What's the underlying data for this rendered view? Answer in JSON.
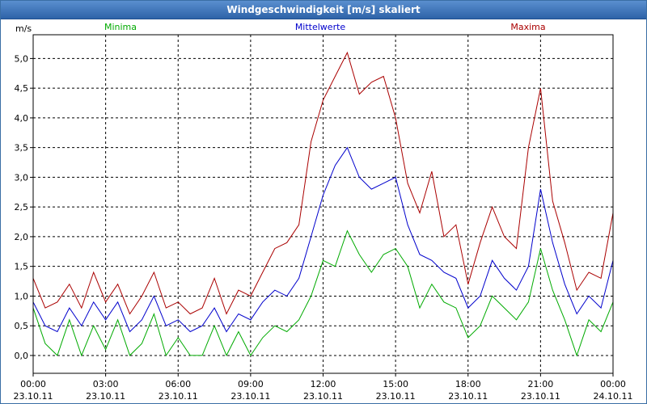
{
  "window": {
    "title": "Windgeschwindigkeit [m/s] skaliert"
  },
  "chart_data": {
    "type": "line",
    "title": "Windgeschwindigkeit [m/s] skaliert",
    "ylabel": "m/s",
    "xlabel": "",
    "ylim": [
      -0.3,
      5.4
    ],
    "yticks": [
      {
        "value": 0.0,
        "label": "0,0"
      },
      {
        "value": 0.5,
        "label": "0,5"
      },
      {
        "value": 1.0,
        "label": "1,0"
      },
      {
        "value": 1.5,
        "label": "1,5"
      },
      {
        "value": 2.0,
        "label": "2,0"
      },
      {
        "value": 2.5,
        "label": "2,5"
      },
      {
        "value": 3.0,
        "label": "3,0"
      },
      {
        "value": 3.5,
        "label": "3,5"
      },
      {
        "value": 4.0,
        "label": "4,0"
      },
      {
        "value": 4.5,
        "label": "4,5"
      },
      {
        "value": 5.0,
        "label": "5,0"
      }
    ],
    "xrange_hours": [
      0,
      24
    ],
    "xticks": [
      {
        "hours": 0,
        "time": "00:00",
        "date": "23.10.11"
      },
      {
        "hours": 3,
        "time": "03:00",
        "date": "23.10.11"
      },
      {
        "hours": 6,
        "time": "06:00",
        "date": "23.10.11"
      },
      {
        "hours": 9,
        "time": "09:00",
        "date": "23.10.11"
      },
      {
        "hours": 12,
        "time": "12:00",
        "date": "23.10.11"
      },
      {
        "hours": 15,
        "time": "15:00",
        "date": "23.10.11"
      },
      {
        "hours": 18,
        "time": "18:00",
        "date": "23.10.11"
      },
      {
        "hours": 21,
        "time": "21:00",
        "date": "23.10.11"
      },
      {
        "hours": 24,
        "time": "00:00",
        "date": "24.10.11"
      }
    ],
    "grid": true,
    "legend_placement": "top",
    "series": [
      {
        "name": "Minima",
        "color": "#00aa00",
        "x": [
          0,
          0.5,
          1,
          1.5,
          2,
          2.5,
          3,
          3.5,
          4,
          4.5,
          5,
          5.5,
          6,
          6.5,
          7,
          7.5,
          8,
          8.5,
          9,
          9.5,
          10,
          10.5,
          11,
          11.5,
          12,
          12.5,
          13,
          13.5,
          14,
          14.5,
          15,
          15.5,
          16,
          16.5,
          17,
          17.5,
          18,
          18.5,
          19,
          19.5,
          20,
          20.5,
          21,
          21.5,
          22,
          22.5,
          23,
          23.5,
          24
        ],
        "values": [
          0.8,
          0.2,
          0.0,
          0.6,
          0.0,
          0.5,
          0.1,
          0.6,
          0.0,
          0.2,
          0.7,
          0.0,
          0.3,
          0.0,
          0.0,
          0.5,
          0.0,
          0.4,
          0.0,
          0.3,
          0.5,
          0.4,
          0.6,
          1.0,
          1.6,
          1.5,
          2.1,
          1.7,
          1.4,
          1.7,
          1.8,
          1.5,
          0.8,
          1.2,
          0.9,
          0.8,
          0.3,
          0.5,
          1.0,
          0.8,
          0.6,
          0.9,
          1.8,
          1.1,
          0.6,
          0.0,
          0.6,
          0.4,
          0.9
        ]
      },
      {
        "name": "Mittelwerte",
        "color": "#0000cc",
        "x": [
          0,
          0.5,
          1,
          1.5,
          2,
          2.5,
          3,
          3.5,
          4,
          4.5,
          5,
          5.5,
          6,
          6.5,
          7,
          7.5,
          8,
          8.5,
          9,
          9.5,
          10,
          10.5,
          11,
          11.5,
          12,
          12.5,
          13,
          13.5,
          14,
          14.5,
          15,
          15.5,
          16,
          16.5,
          17,
          17.5,
          18,
          18.5,
          19,
          19.5,
          20,
          20.5,
          21,
          21.5,
          22,
          22.5,
          23,
          23.5,
          24
        ],
        "values": [
          0.9,
          0.5,
          0.4,
          0.8,
          0.5,
          0.9,
          0.6,
          0.9,
          0.4,
          0.6,
          1.0,
          0.5,
          0.6,
          0.4,
          0.5,
          0.8,
          0.4,
          0.7,
          0.6,
          0.9,
          1.1,
          1.0,
          1.3,
          2.0,
          2.7,
          3.2,
          3.5,
          3.0,
          2.8,
          2.9,
          3.0,
          2.2,
          1.7,
          1.6,
          1.4,
          1.3,
          0.8,
          1.0,
          1.6,
          1.3,
          1.1,
          1.5,
          2.8,
          1.9,
          1.2,
          0.7,
          1.0,
          0.8,
          1.6
        ]
      },
      {
        "name": "Maxima",
        "color": "#aa0000",
        "x": [
          0,
          0.5,
          1,
          1.5,
          2,
          2.5,
          3,
          3.5,
          4,
          4.5,
          5,
          5.5,
          6,
          6.5,
          7,
          7.5,
          8,
          8.5,
          9,
          9.5,
          10,
          10.5,
          11,
          11.5,
          12,
          12.5,
          13,
          13.5,
          14,
          14.5,
          15,
          15.5,
          16,
          16.5,
          17,
          17.5,
          18,
          18.5,
          19,
          19.5,
          20,
          20.5,
          21,
          21.5,
          22,
          22.5,
          23,
          23.5,
          24
        ],
        "values": [
          1.3,
          0.8,
          0.9,
          1.2,
          0.8,
          1.4,
          0.9,
          1.2,
          0.7,
          1.0,
          1.4,
          0.8,
          0.9,
          0.7,
          0.8,
          1.3,
          0.7,
          1.1,
          1.0,
          1.4,
          1.8,
          1.9,
          2.2,
          3.6,
          4.3,
          4.7,
          5.1,
          4.4,
          4.6,
          4.7,
          4.0,
          2.9,
          2.4,
          3.1,
          2.0,
          2.2,
          1.2,
          1.9,
          2.5,
          2.0,
          1.8,
          3.5,
          4.5,
          2.6,
          1.9,
          1.1,
          1.4,
          1.3,
          2.4
        ]
      }
    ]
  }
}
